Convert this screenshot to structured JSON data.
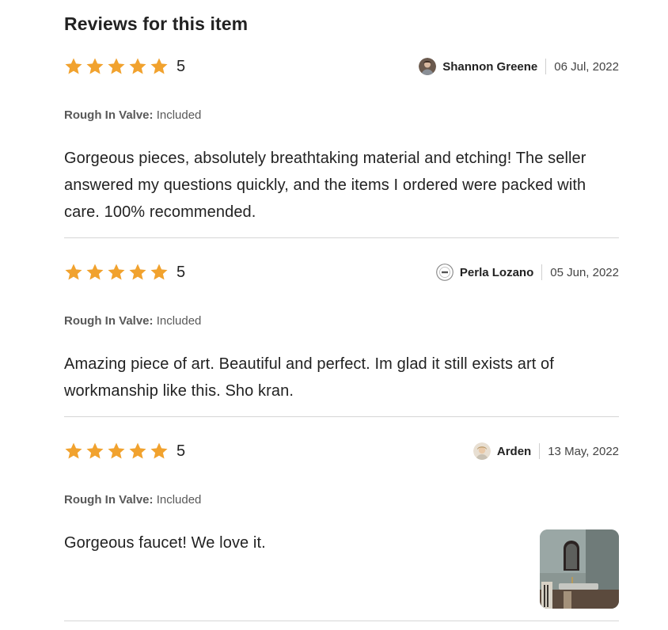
{
  "title": "Reviews for this item",
  "colors": {
    "star": "#F1A22E",
    "text": "#222222",
    "muted": "#595959",
    "divider": "#D6D6D6"
  },
  "reviews": [
    {
      "rating": "5",
      "stars": 5,
      "reviewer": "Shannon Greene",
      "date": "06 Jul, 2022",
      "avatar_icon": "user-photo-avatar",
      "variation_label": "Rough In Valve:",
      "variation_value": "Included",
      "text": "Gorgeous pieces, absolutely breathtaking material and etching! The seller answered my questions quickly, and the items I ordered were packed with care. 100% recommended.",
      "has_photo": false
    },
    {
      "rating": "5",
      "stars": 5,
      "reviewer": "Perla Lozano",
      "date": "05 Jun, 2022",
      "avatar_icon": "logo-badge-avatar",
      "variation_label": "Rough In Valve:",
      "variation_value": "Included",
      "text": "Amazing piece of art. Beautiful and perfect. Im glad it still exists art of workmanship like this. Sho kran.",
      "has_photo": false
    },
    {
      "rating": "5",
      "stars": 5,
      "reviewer": "Arden",
      "date": "13 May, 2022",
      "avatar_icon": "user-photo-avatar",
      "variation_label": "Rough In Valve:",
      "variation_value": "Included",
      "text": "Gorgeous faucet! We love it.",
      "has_photo": true
    }
  ]
}
